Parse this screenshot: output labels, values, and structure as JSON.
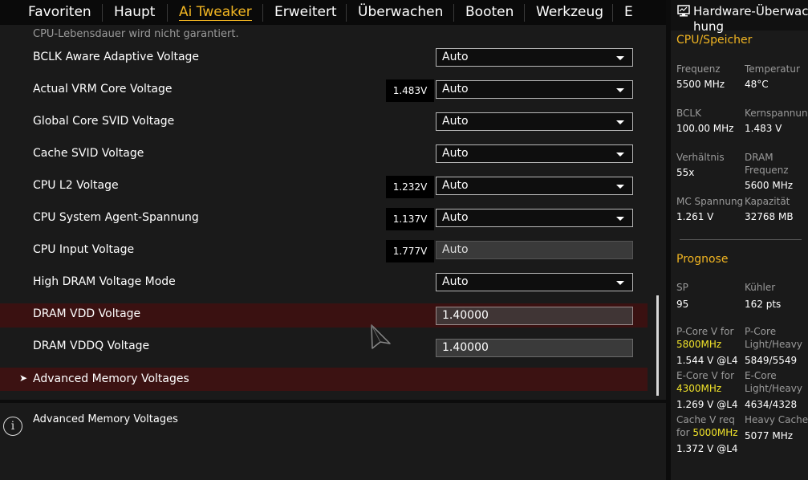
{
  "nav": {
    "tabs": [
      {
        "label": "Favoriten"
      },
      {
        "label": "Haupt"
      },
      {
        "label": "Ai Tweaker"
      },
      {
        "label": "Erweitert"
      },
      {
        "label": "Überwachen"
      },
      {
        "label": "Booten"
      },
      {
        "label": "Werkzeug"
      },
      {
        "label": "E"
      }
    ],
    "active_tab": "Ai Tweaker"
  },
  "main": {
    "warning_text": "CPU-Lebensdauer wird nicht garantiert.",
    "rows": [
      {
        "label": "BCLK Aware Adaptive Voltage",
        "value": "",
        "setting": "Auto"
      },
      {
        "label": "Actual VRM Core Voltage",
        "value": "1.483V",
        "setting": "Auto"
      },
      {
        "label": "Global Core SVID Voltage",
        "value": "",
        "setting": "Auto"
      },
      {
        "label": "Cache SVID Voltage",
        "value": "",
        "setting": "Auto"
      },
      {
        "label": "CPU L2 Voltage",
        "value": "1.232V",
        "setting": "Auto"
      },
      {
        "label": "CPU System Agent-Spannung",
        "value": "1.137V",
        "setting": "Auto"
      },
      {
        "label": "CPU Input Voltage",
        "value": "1.777V",
        "setting": "Auto"
      },
      {
        "label": "High DRAM Voltage Mode",
        "value": "",
        "setting": "Auto"
      },
      {
        "label": "DRAM VDD Voltage",
        "value": "",
        "setting": "1.40000"
      },
      {
        "label": "DRAM VDDQ Voltage",
        "value": "",
        "setting": "1.40000"
      }
    ],
    "submenu": {
      "label": "Advanced Memory Voltages",
      "chevron": "➤"
    }
  },
  "help": {
    "text": "Advanced Memory Voltages",
    "icon": "info-icon",
    "icon_glyph": "i"
  },
  "panel": {
    "title": "Hardware-Überwachung",
    "icon": "monitor-icon",
    "cpu_mem": {
      "heading": "CPU/Speicher",
      "items": [
        {
          "label": "Frequenz",
          "value": "5500 MHz"
        },
        {
          "label": "Temperatur",
          "value": "48°C"
        },
        {
          "label": "BCLK",
          "value": "100.00 MHz"
        },
        {
          "label": "Kernspannung",
          "value": "1.483 V"
        },
        {
          "label": "Verhältnis",
          "value": "55x"
        },
        {
          "label": "DRAM Frequenz",
          "value": "5600 MHz"
        },
        {
          "label": "MC Spannung",
          "value": "1.261 V"
        },
        {
          "label": "Kapazität",
          "value": "32768 MB"
        }
      ]
    },
    "forecast": {
      "heading": "Prognose",
      "sp_label": "SP",
      "sp_value": "95",
      "cooler_label": "Kühler",
      "cooler_value": "162 pts",
      "pcore_label": "P-Core V for",
      "pcore_freq": "5800MHz",
      "pcore_value": "1.544 V @L4",
      "pcore_lh_label": "P-Core Light/Heavy",
      "pcore_lh_value": "5849/5549",
      "ecore_label": "E-Core V for",
      "ecore_freq": "4300MHz",
      "ecore_value": "1.269 V @L4",
      "ecore_lh_label": "E-Core Light/Heavy",
      "ecore_lh_value": "4634/4328",
      "cache_label": "Cache V req",
      "cache_for": "for",
      "cache_freq": "5000MHz",
      "cache_value": "1.372 V @L4",
      "hcache_label": "Heavy Cache",
      "hcache_value": "5077 MHz"
    }
  },
  "colors": {
    "accent": "#f1b522",
    "highlight_row": "#3a1111",
    "freq_highlight": "#f0e22a"
  }
}
